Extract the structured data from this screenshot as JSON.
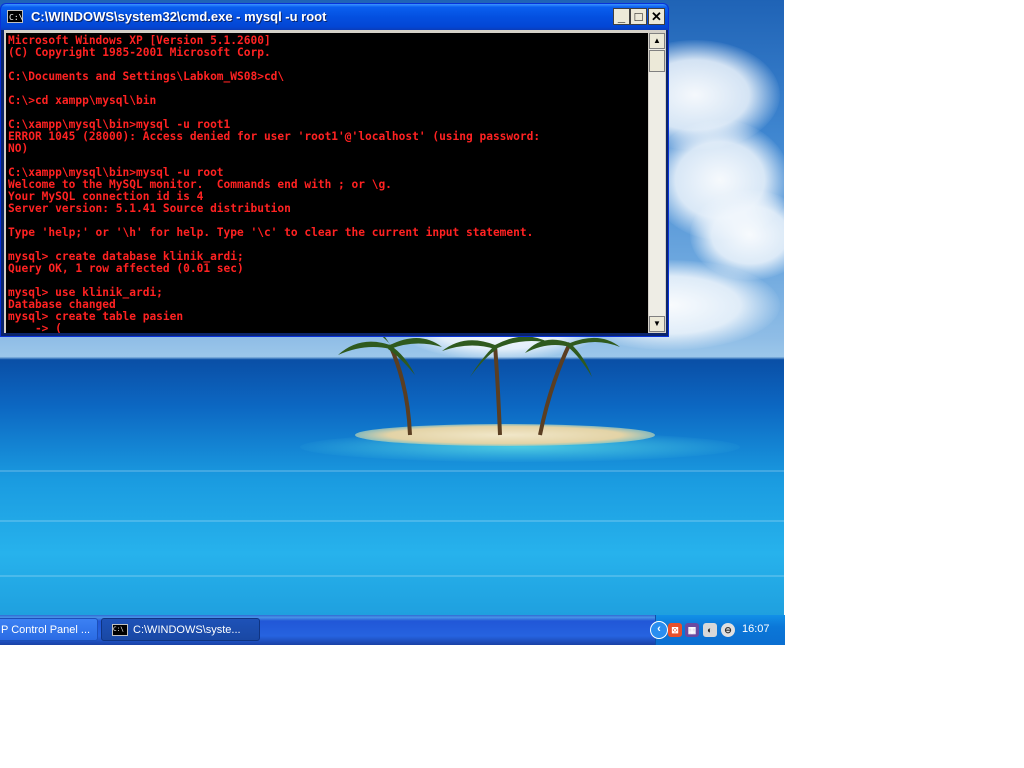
{
  "window": {
    "title": "C:\\WINDOWS\\system32\\cmd.exe - mysql -u root",
    "icon_text": "C:\\",
    "minimize_glyph": "_",
    "maximize_glyph": "□",
    "close_glyph": "✕"
  },
  "console": {
    "text_color": "#ff2222",
    "background": "#000000",
    "lines": [
      "Microsoft Windows XP [Version 5.1.2600]",
      "(C) Copyright 1985-2001 Microsoft Corp.",
      "",
      "C:\\Documents and Settings\\Labkom_WS08>cd\\",
      "",
      "C:\\>cd xampp\\mysql\\bin",
      "",
      "C:\\xampp\\mysql\\bin>mysql -u root1",
      "ERROR 1045 (28000): Access denied for user 'root1'@'localhost' (using password:",
      "NO)",
      "",
      "C:\\xampp\\mysql\\bin>mysql -u root",
      "Welcome to the MySQL monitor.  Commands end with ; or \\g.",
      "Your MySQL connection id is 4",
      "Server version: 5.1.41 Source distribution",
      "",
      "Type 'help;' or '\\h' for help. Type '\\c' to clear the current input statement.",
      "",
      "mysql> create database klinik_ardi;",
      "Query OK, 1 row affected (0.01 sec)",
      "",
      "mysql> use klinik_ardi;",
      "Database changed",
      "mysql> create table pasien",
      "    -> ("
    ]
  },
  "scrollbar": {
    "up_glyph": "▲",
    "down_glyph": "▼"
  },
  "taskbar": {
    "buttons": [
      {
        "label": "P Control Panel ..."
      },
      {
        "label": "C:\\WINDOWS\\syste...",
        "icon_text": "C:\\"
      }
    ],
    "tray": {
      "chevron_glyph": "‹",
      "icons": [
        "xampp-icon",
        "network-icon",
        "volume-icon",
        "security-icon"
      ],
      "clock": "16:07"
    }
  }
}
